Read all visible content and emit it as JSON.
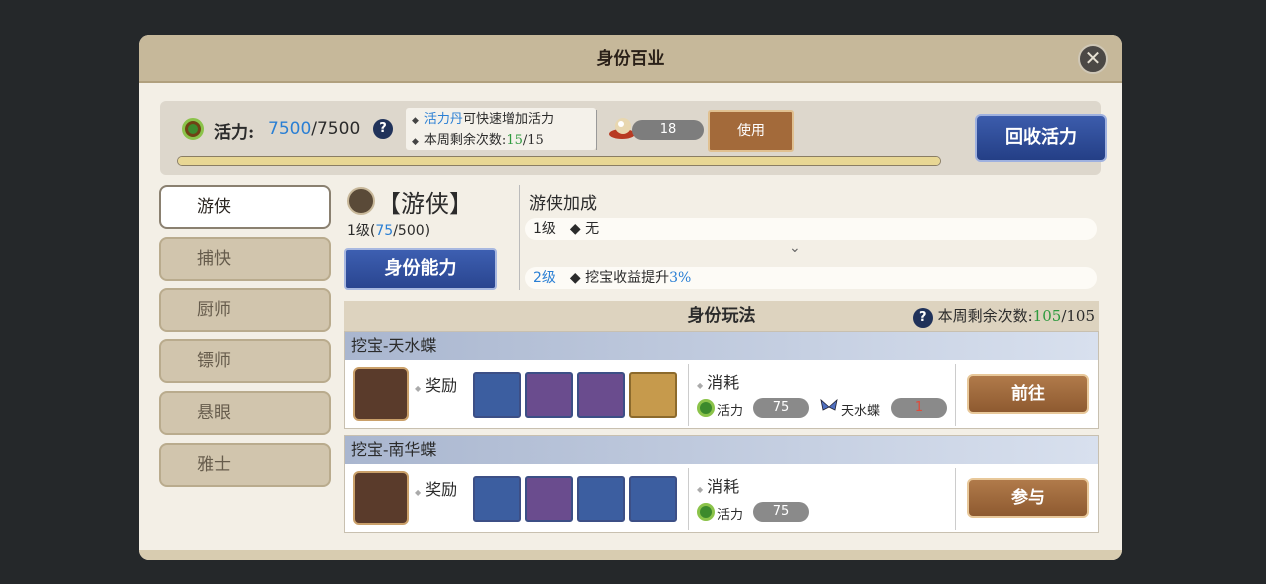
{
  "dialog": {
    "title": "身份百业"
  },
  "energy": {
    "label": "活力:",
    "current": "7500",
    "max": "/7500",
    "progress": 1.0,
    "tip_highlight": "活力丹",
    "tip_line1": "可快速增加活力",
    "tip_line2": "本周剩余次数:",
    "tip_remaining": "15",
    "tip_total": "/15",
    "item_count": "18",
    "use_label": "使用",
    "recycle_label": "回收活力"
  },
  "tabs": [
    {
      "label": "游侠"
    },
    {
      "label": "捕快"
    },
    {
      "label": "厨师"
    },
    {
      "label": "镖师"
    },
    {
      "label": "悬眼"
    },
    {
      "label": "雅士"
    }
  ],
  "role": {
    "title": "【游侠】",
    "level_prefix": "1级(",
    "exp_current": "75",
    "exp_total": "/500)",
    "ability_label": "身份能力"
  },
  "bonus": {
    "title": "游侠加成",
    "row1_level": "1级",
    "row1_text": "无",
    "row2_level": "2级",
    "row2_text": "挖宝收益提升",
    "row2_value": "3%"
  },
  "gameplay": {
    "title": "身份玩法",
    "remaining_label": "本周剩余次数:",
    "remaining": "105",
    "total": "/105"
  },
  "cards": [
    {
      "title": "挖宝-天水蝶",
      "reward_label": "奖励",
      "cost_label": "消耗",
      "cost_energy_label": "活力",
      "cost_energy": "75",
      "cost_item_label": "天水蝶",
      "cost_item": "1",
      "button": "前往"
    },
    {
      "title": "挖宝-南华蝶",
      "reward_label": "奖励",
      "cost_label": "消耗",
      "cost_energy_label": "活力",
      "cost_energy": "75",
      "button": "参与"
    }
  ],
  "colors": {
    "accent_blue": "#2a7fd4",
    "accent_green": "#2e9a3e",
    "button_blue": "#2a4590",
    "button_brown": "#8e5a30"
  }
}
